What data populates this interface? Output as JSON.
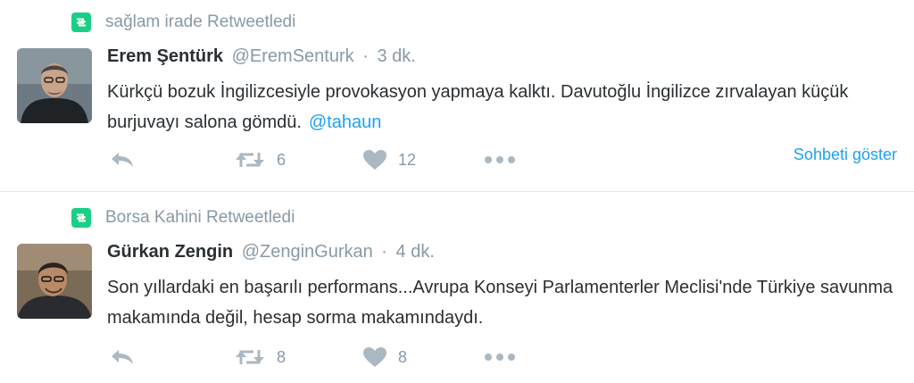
{
  "tweets": [
    {
      "retweeter_line": "sağlam irade Retweetledi",
      "name": "Erem Şentürk",
      "handle": "@EremSenturk",
      "separator": "·",
      "time": "3 dk.",
      "text": "Kürkçü bozuk İngilizcesiyle provokasyon yapmaya kalktı. Davutoğlu İngilizce zırvalayan küçük burjuvayı salona gömdü.",
      "mention": "@tahaun",
      "retweet_count": "6",
      "like_count": "12",
      "show_conversation": "Sohbeti göster"
    },
    {
      "retweeter_line": "Borsa Kahini Retweetledi",
      "name": "Gürkan Zengin",
      "handle": "@ZenginGurkan",
      "separator": "·",
      "time": "4 dk.",
      "text": "Son yıllardaki en başarılı performans...Avrupa Konseyi Parlamenterler Meclisi'nde Türkiye savunma makamında değil, hesap sorma makamındaydı.",
      "retweet_count": "8",
      "like_count": "8"
    }
  ],
  "icons": {
    "retweet_badge": "retweet-icon",
    "reply": "reply-icon",
    "retweet": "retweet-icon",
    "like": "heart-icon",
    "more": "more-icon"
  },
  "colors": {
    "retweet_green": "#19cf86",
    "link_blue": "#1da1f2",
    "muted_gray": "#8899a6",
    "icon_gray": "#aab8c2",
    "text_dark": "#292f33"
  }
}
